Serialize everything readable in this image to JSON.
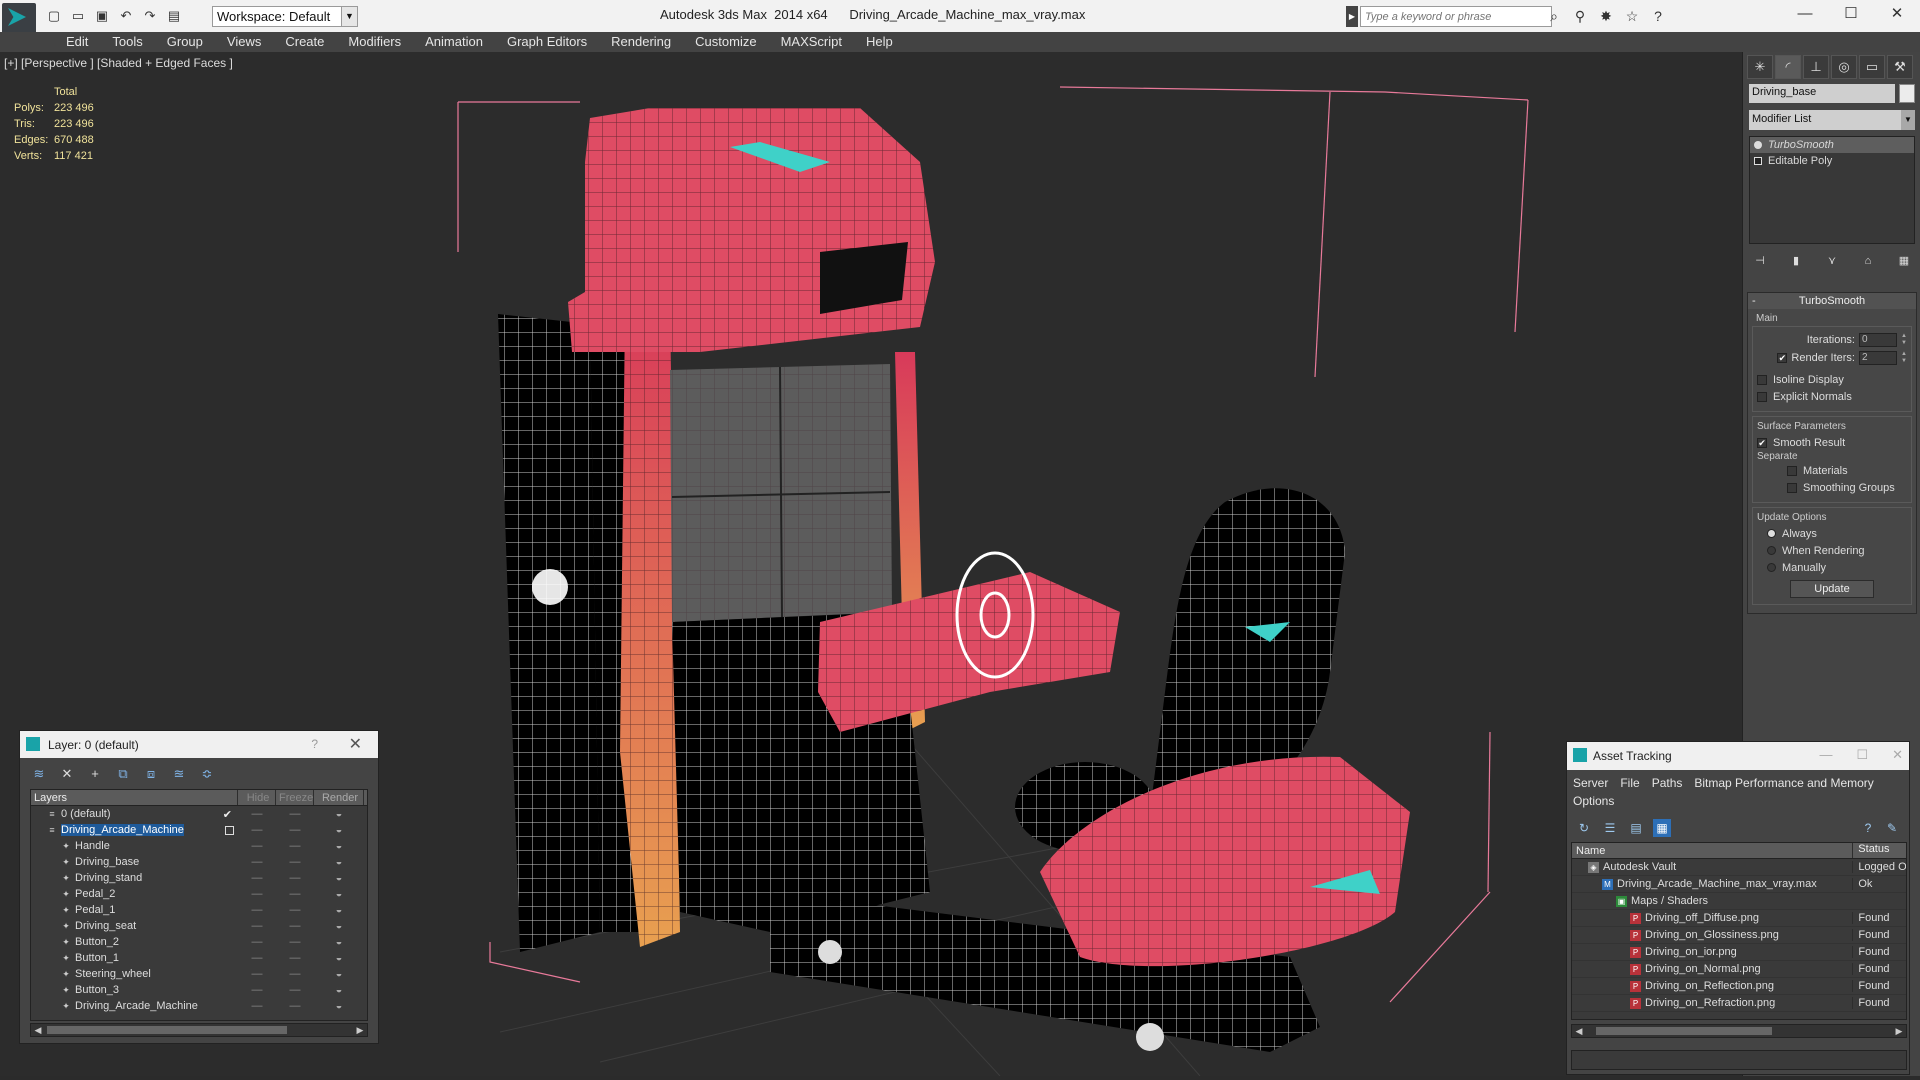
{
  "title_bar": {
    "app_title": "Autodesk 3ds Max  2014 x64",
    "file_title": "Driving_Arcade_Machine_max_vray.max",
    "workspace": "Workspace: Default",
    "search_placeholder": "Type a keyword or phrase",
    "qa_icons": [
      "new-file-icon",
      "open-file-icon",
      "save-icon",
      "undo-icon",
      "redo-icon",
      "project-folder-icon"
    ],
    "search_tools": [
      "binoculars-icon",
      "search-icon",
      "communication-center-icon",
      "favorites-star-icon",
      "help-icon"
    ],
    "window_controls": [
      "minimize-icon",
      "maximize-icon",
      "close-icon"
    ]
  },
  "menu": [
    "Edit",
    "Tools",
    "Group",
    "Views",
    "Create",
    "Modifiers",
    "Animation",
    "Graph Editors",
    "Rendering",
    "Customize",
    "MAXScript",
    "Help"
  ],
  "viewport": {
    "label": "[+] [Perspective ] [Shaded + Edged Faces ]",
    "stats_header": "Total",
    "stats": [
      {
        "label": "Polys:",
        "value": "223 496"
      },
      {
        "label": "Tris:",
        "value": "223 496"
      },
      {
        "label": "Edges:",
        "value": "670 488"
      },
      {
        "label": "Verts:",
        "value": "117 421"
      }
    ]
  },
  "command_panel": {
    "tabs": [
      "create-tab-icon",
      "modify-tab-icon",
      "hierarchy-tab-icon",
      "motion-tab-icon",
      "display-tab-icon",
      "utilities-tab-icon"
    ],
    "object_name": "Driving_base",
    "modifier_list": "Modifier List",
    "stack": [
      "TurboSmooth",
      "Editable Poly"
    ],
    "stack_tools": [
      "pin-stack-icon",
      "show-end-result-icon",
      "make-unique-icon",
      "remove-modifier-icon",
      "configure-modifier-sets-icon"
    ],
    "rollout_title": "TurboSmooth",
    "main_label": "Main",
    "iterations_label": "Iterations:",
    "iterations_value": "0",
    "render_iters_label": "Render Iters:",
    "render_iters_value": "2",
    "isoline_display": "Isoline Display",
    "explicit_normals": "Explicit Normals",
    "surface_params_label": "Surface Parameters",
    "smooth_result": "Smooth Result",
    "separate_label": "Separate",
    "materials": "Materials",
    "smoothing_groups": "Smoothing Groups",
    "update_options_label": "Update Options",
    "always": "Always",
    "when_rendering": "When Rendering",
    "manually": "Manually",
    "update_button": "Update"
  },
  "layer_manager": {
    "title": "Layer: 0 (default)",
    "help": "?",
    "toolbar": [
      "create-layer-icon",
      "delete-layer-icon",
      "add-to-layer-icon",
      "select-objects-icon",
      "select-layer-icon",
      "hide-all-icon",
      "freeze-all-icon"
    ],
    "columns": [
      "Layers",
      "Hide",
      "Freeze",
      "Render"
    ],
    "rows": [
      {
        "name": "0 (default)",
        "level": 0
      },
      {
        "name": "Driving_Arcade_Machine",
        "level": 0
      },
      {
        "name": "Handle",
        "level": 1
      },
      {
        "name": "Driving_base",
        "level": 1
      },
      {
        "name": "Driving_stand",
        "level": 1
      },
      {
        "name": "Pedal_2",
        "level": 1
      },
      {
        "name": "Pedal_1",
        "level": 1
      },
      {
        "name": "Driving_seat",
        "level": 1
      },
      {
        "name": "Button_2",
        "level": 1
      },
      {
        "name": "Button_1",
        "level": 1
      },
      {
        "name": "Steering_wheel",
        "level": 1
      },
      {
        "name": "Button_3",
        "level": 1
      },
      {
        "name": "Driving_Arcade_Machine",
        "level": 1
      }
    ]
  },
  "asset_tracking": {
    "title": "Asset Tracking",
    "menu": [
      "Server",
      "File",
      "Paths",
      "Bitmap Performance and Memory",
      "Options"
    ],
    "toolbar": [
      "refresh-icon",
      "list-view-icon",
      "tree-view-icon",
      "table-view-icon",
      "help-icon",
      "highlight-icon"
    ],
    "columns": [
      "Name",
      "Status"
    ],
    "rows": [
      {
        "name": "Autodesk Vault",
        "status": "Logged O",
        "level": 0
      },
      {
        "name": "Driving_Arcade_Machine_max_vray.max",
        "status": "Ok",
        "level": 1
      },
      {
        "name": "Maps / Shaders",
        "status": "",
        "level": 2
      },
      {
        "name": "Driving_off_Diffuse.png",
        "status": "Found",
        "level": 3
      },
      {
        "name": "Driving_on_Glossiness.png",
        "status": "Found",
        "level": 3
      },
      {
        "name": "Driving_on_ior.png",
        "status": "Found",
        "level": 3
      },
      {
        "name": "Driving_on_Normal.png",
        "status": "Found",
        "level": 3
      },
      {
        "name": "Driving_on_Reflection.png",
        "status": "Found",
        "level": 3
      },
      {
        "name": "Driving_on_Refraction.png",
        "status": "Found",
        "level": 3
      }
    ]
  },
  "colors": {
    "selection_blue": "#1e5a9a",
    "stats_yellow": "#f0e29a",
    "model_red": "#e05a6a",
    "screen_gray": "#5a5a5a",
    "bbox_pink": "#e87a9a"
  }
}
